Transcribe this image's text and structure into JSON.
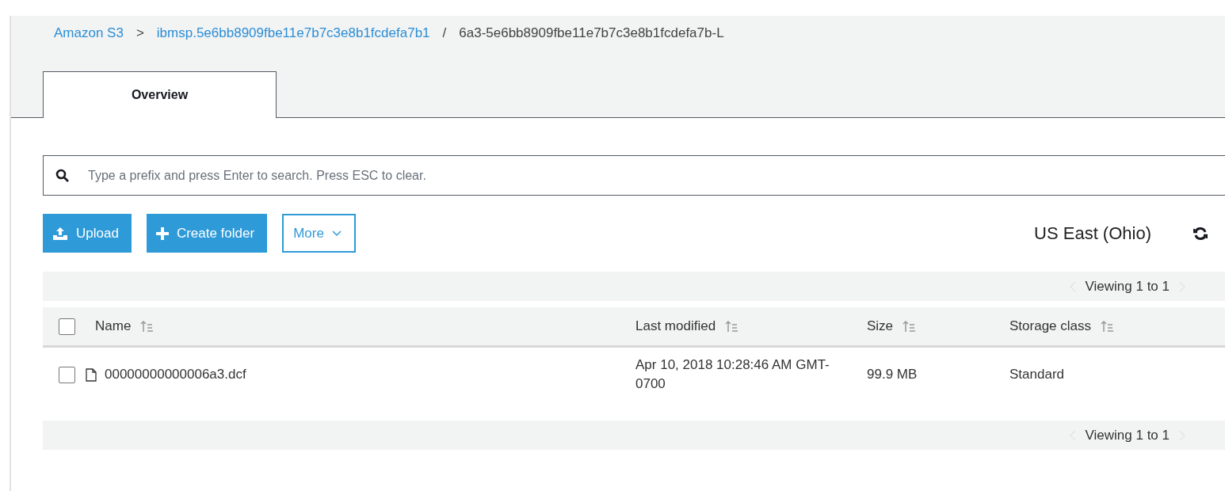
{
  "breadcrumb": [
    {
      "label": "Amazon S3",
      "kind": "link"
    },
    {
      "label": ">",
      "kind": "separator"
    },
    {
      "label": "ibmsp.5e6bb8909fbe11e7b7c3e8b1fcdefa7b1",
      "kind": "link"
    },
    {
      "label": "/",
      "kind": "separator"
    },
    {
      "label": "6a3-5e6bb8909fbe11e7b7c3e8b1fcdefa7b-L",
      "kind": "current"
    }
  ],
  "tabs": [
    {
      "label": "Overview",
      "selected": true
    }
  ],
  "search": {
    "placeholder": "Type a prefix and press Enter to search. Press ESC to clear."
  },
  "toolbar": {
    "buttons": [
      {
        "label": "Upload",
        "kind": "upload"
      },
      {
        "label": "Create folder",
        "kind": "create"
      },
      {
        "label": "More",
        "kind": "menu"
      }
    ],
    "region": "US East (Ohio)"
  },
  "pagination_top": "Viewing 1 to 1",
  "table": {
    "select_all_checked": false,
    "columns": [
      "Name",
      "Last modified",
      "Size",
      "Storage class"
    ],
    "rows": [
      {
        "checked": false,
        "name": "00000000000006a3.dcf",
        "last_modified": "Apr 10, 2018 10:28:46 AM GMT-0700",
        "size": "99.9 MB",
        "storage_class": "Standard"
      }
    ]
  },
  "pagination_bottom": "Viewing 1 to 1"
}
